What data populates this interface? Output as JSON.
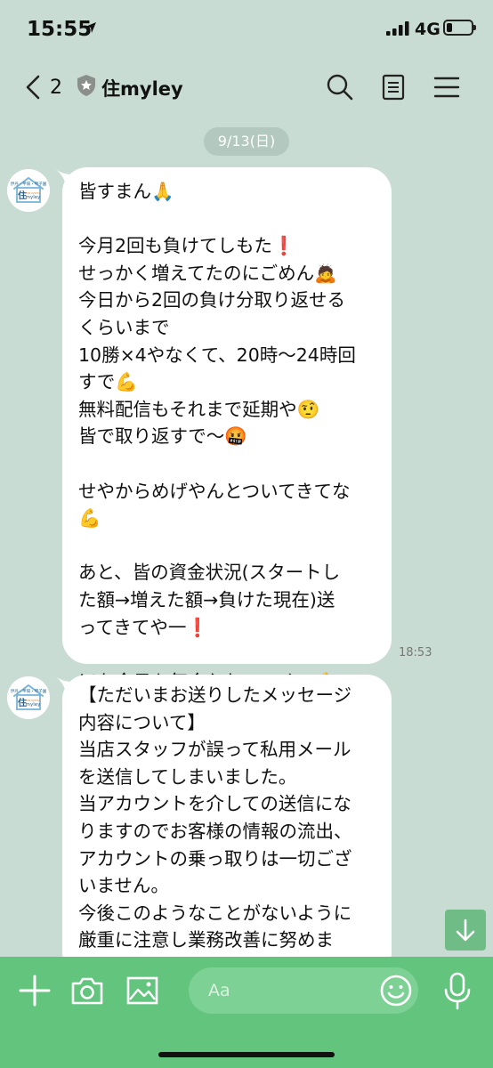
{
  "status_bar": {
    "time": "15:55",
    "network": "4G"
  },
  "header": {
    "back_count": "2",
    "title": "住myley"
  },
  "date_label": "9/13(日)",
  "avatar_text": {
    "line1": "伊丹・甲陽・甲子園",
    "brand_char": "住",
    "brand_small": "maruyama",
    "brand_name": "myley"
  },
  "messages": [
    {
      "text": "皆すまん🙏\n\n今月2回も負けてしもた❗\nせっかく増えてたのにごめん🙇\n今日から2回の負け分取り返せる\nくらいまで\n10勝×4やなくて、20時〜24時回\nすで💪\n無料配信もそれまで延期や🤨\n皆で取り返すで〜🤬\n\nせやからめげやんとついてきてな\n💪\n\nあと、皆の資金状況(スタートし\nた額→増えた額→負けた現在)送\nってきてや一❗\n\nほな今日も気合入れていくで💪",
      "time": "18:53"
    },
    {
      "text": "【ただいまお送りしたメッセージ\n内容について】\n当店スタッフが誤って私用メール\nを送信してしまいました。\n当アカウントを介しての送信にな\nりますのでお客様の情報の流出、\nアカウントの乗っ取りは一切ござ\nいません。\n今後このようなことがないように\n厳重に注意し業務改善に努めま\nす。"
    }
  ],
  "input": {
    "placeholder": "Aa"
  },
  "icons": {
    "header": [
      "chevron-left-icon",
      "shield-icon",
      "search-icon",
      "note-icon",
      "menu-icon"
    ],
    "toolbar": [
      "plus-icon",
      "camera-icon",
      "image-icon",
      "emoji-icon",
      "microphone-icon"
    ],
    "scroll": "arrow-down-icon"
  },
  "colors": {
    "chat_background": "#c9dcd3",
    "toolbar": "#62c47d",
    "date_pill": "#b3c8bf",
    "bubble": "#ffffff",
    "scroll_button": "#6fbc87"
  }
}
